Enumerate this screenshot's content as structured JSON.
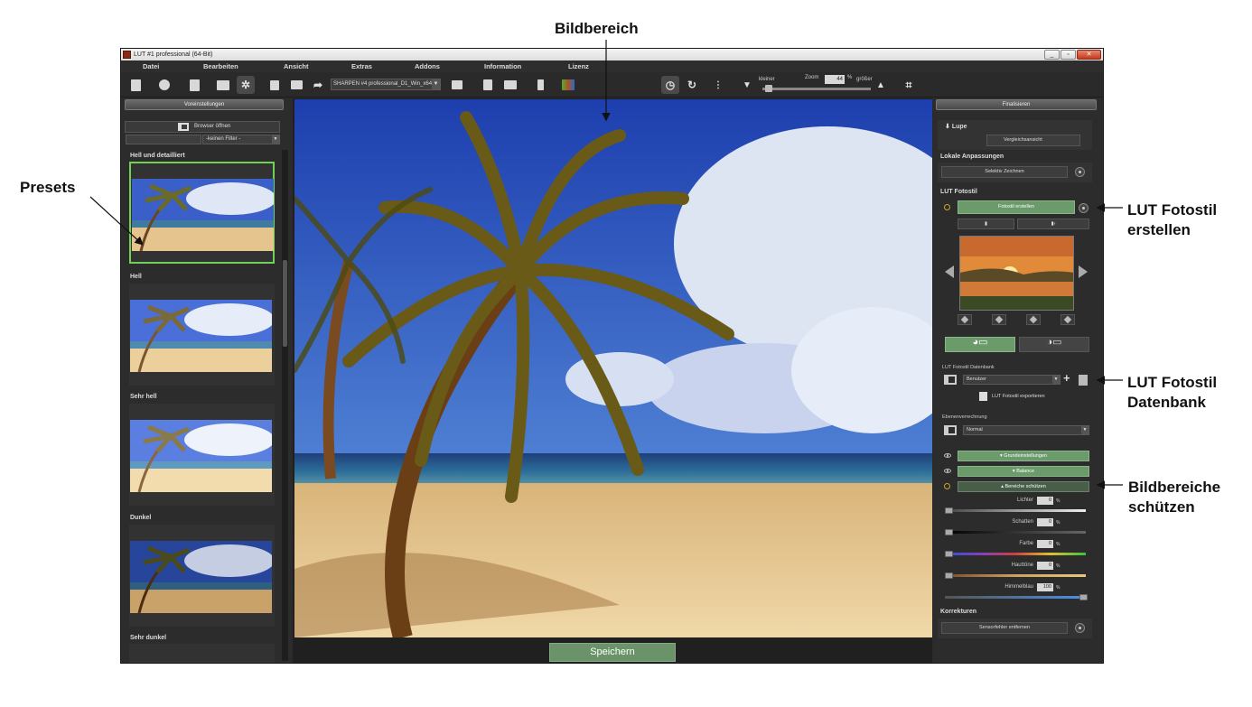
{
  "annotations": {
    "bildbereich": "Bildbereich",
    "presets": "Presets",
    "lut_erstellen_1": "LUT Fotostil",
    "lut_erstellen_2": "erstellen",
    "lut_db_1": "LUT Fotostil",
    "lut_db_2": "Datenbank",
    "schuetzen_1": "Bildbereiche",
    "schuetzen_2": "schützen"
  },
  "window": {
    "title": "LUT #1 professional (64-Bit)"
  },
  "menu": [
    "Datei",
    "Bearbeiten",
    "Ansicht",
    "Extras",
    "Addons",
    "Information",
    "Lizenz"
  ],
  "toolbar": {
    "sharpen": "SHARPEN #4 professional_D1_Win_x64",
    "zoom_label": "Zoom",
    "zoom_value": "44",
    "zoom_unit": "%",
    "smaller": "kleiner",
    "larger": "größer"
  },
  "left": {
    "header": "Voreinstellungen",
    "browser": "Browser öffnen",
    "filter": "-keinen Filter -",
    "presets": [
      "Hell und detailliert",
      "Hell",
      "Sehr hell",
      "Dunkel",
      "Sehr dunkel"
    ]
  },
  "center": {
    "save": "Speichern"
  },
  "right": {
    "header": "Finalisieren",
    "lupe": "Lupe",
    "vergleich": "Vergleichsansicht",
    "lokale": "Lokale Anpassungen",
    "selektiv": "Selektiv Zeichnen",
    "lut_title": "LUT Fotostil",
    "fotostil_erstellen": "Fotostil erstellen",
    "db_title": "LUT Fotostil Datenbank",
    "db_select": "Benutzer",
    "export": "LUT Fotostil exportieren",
    "blend_title": "Ebenenverrechnung",
    "blend_select": "Normal",
    "grund": "Grundeinstellungen",
    "balance": "Balance",
    "bereiche": "Bereiche schützen",
    "sliders": [
      {
        "label": "Lichter",
        "value": "0"
      },
      {
        "label": "Schatten",
        "value": "0"
      },
      {
        "label": "Farbe",
        "value": "0"
      },
      {
        "label": "Hauttöne",
        "value": "0"
      },
      {
        "label": "Himmelblau",
        "value": "100"
      }
    ],
    "pct": "%",
    "korrekturen": "Korrekturen",
    "sensor": "Sensorfehler entfernen"
  }
}
